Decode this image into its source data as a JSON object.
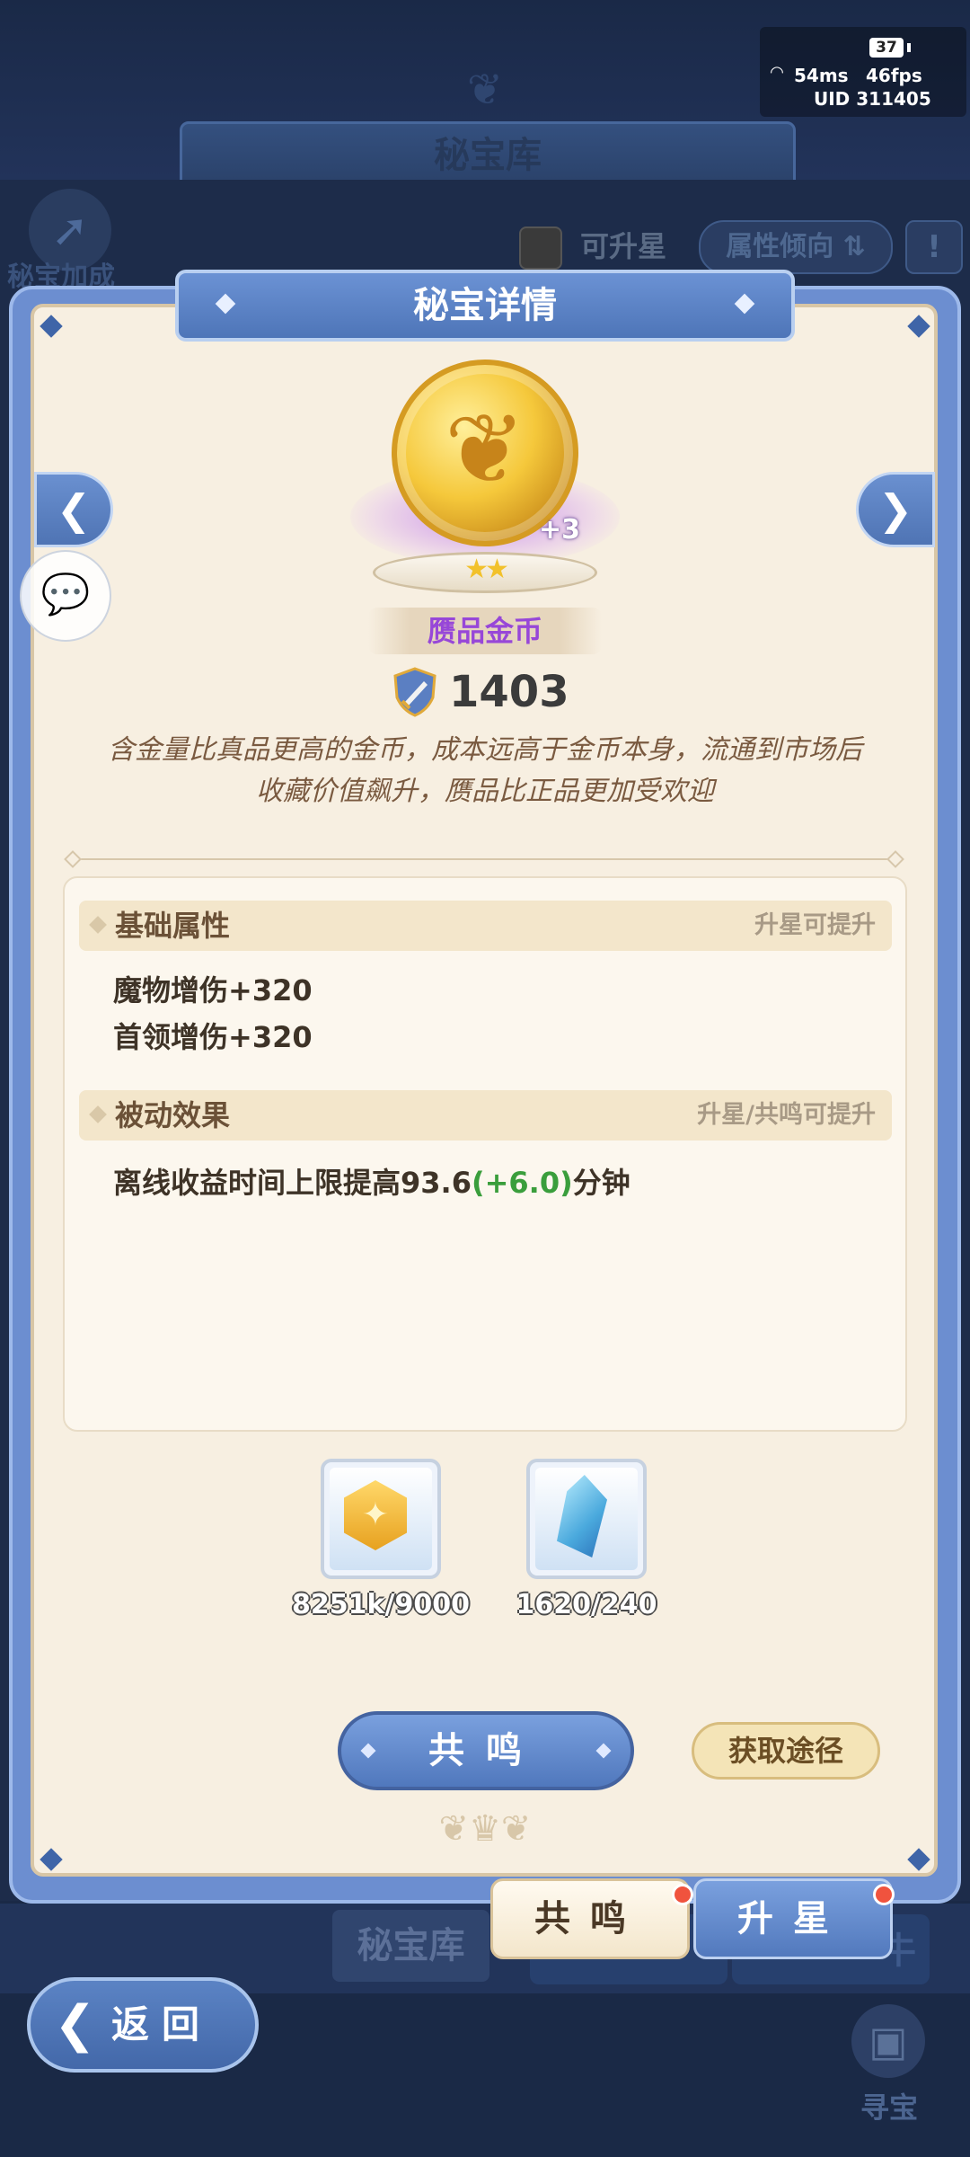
{
  "background": {
    "title": "秘宝库",
    "bonus_label": "秘宝加成",
    "upgradable_filter": "可升星",
    "attribute_filter": "属性倾向",
    "info_button": "!",
    "tab_library": "秘宝库",
    "dark_tab_text": "牛",
    "back_label": "返回",
    "treasure_label": "寻宝"
  },
  "status": {
    "battery": "37",
    "ping": "54ms",
    "fps": "46fps",
    "uid": "UID 311405"
  },
  "modal": {
    "title": "秘宝详情",
    "item": {
      "name": "赝品金币",
      "level_badge": "+3",
      "stars": 2,
      "power": "1403",
      "description": "含金量比真品更高的金币，成本远高于金币本身，流通到市场后收藏价值飙升，赝品比正品更加受欢迎"
    },
    "basic": {
      "title": "基础属性",
      "hint": "升星可提升",
      "stats": [
        "魔物增伤+320",
        "首领增伤+320"
      ]
    },
    "passive": {
      "title": "被动效果",
      "hint": "升星/共鸣可提升",
      "prefix": "离线收益时间上限提高93.6",
      "bonus": "(+6.0)",
      "suffix": "分钟"
    },
    "materials": [
      {
        "icon": "gold-star-hexagon-icon",
        "count": "8251k/9000"
      },
      {
        "icon": "blue-crystal-icon",
        "count": "1620/240"
      }
    ],
    "resonate_button": "共鸣",
    "source_button": "获取途径"
  },
  "tabs": {
    "resonate": "共鸣",
    "upstar": "升星"
  },
  "colors": {
    "accent_blue": "#5078bd",
    "item_name_purple": "#9747d8",
    "bonus_green": "#3a9e3c",
    "notification_red": "#f0533e"
  }
}
